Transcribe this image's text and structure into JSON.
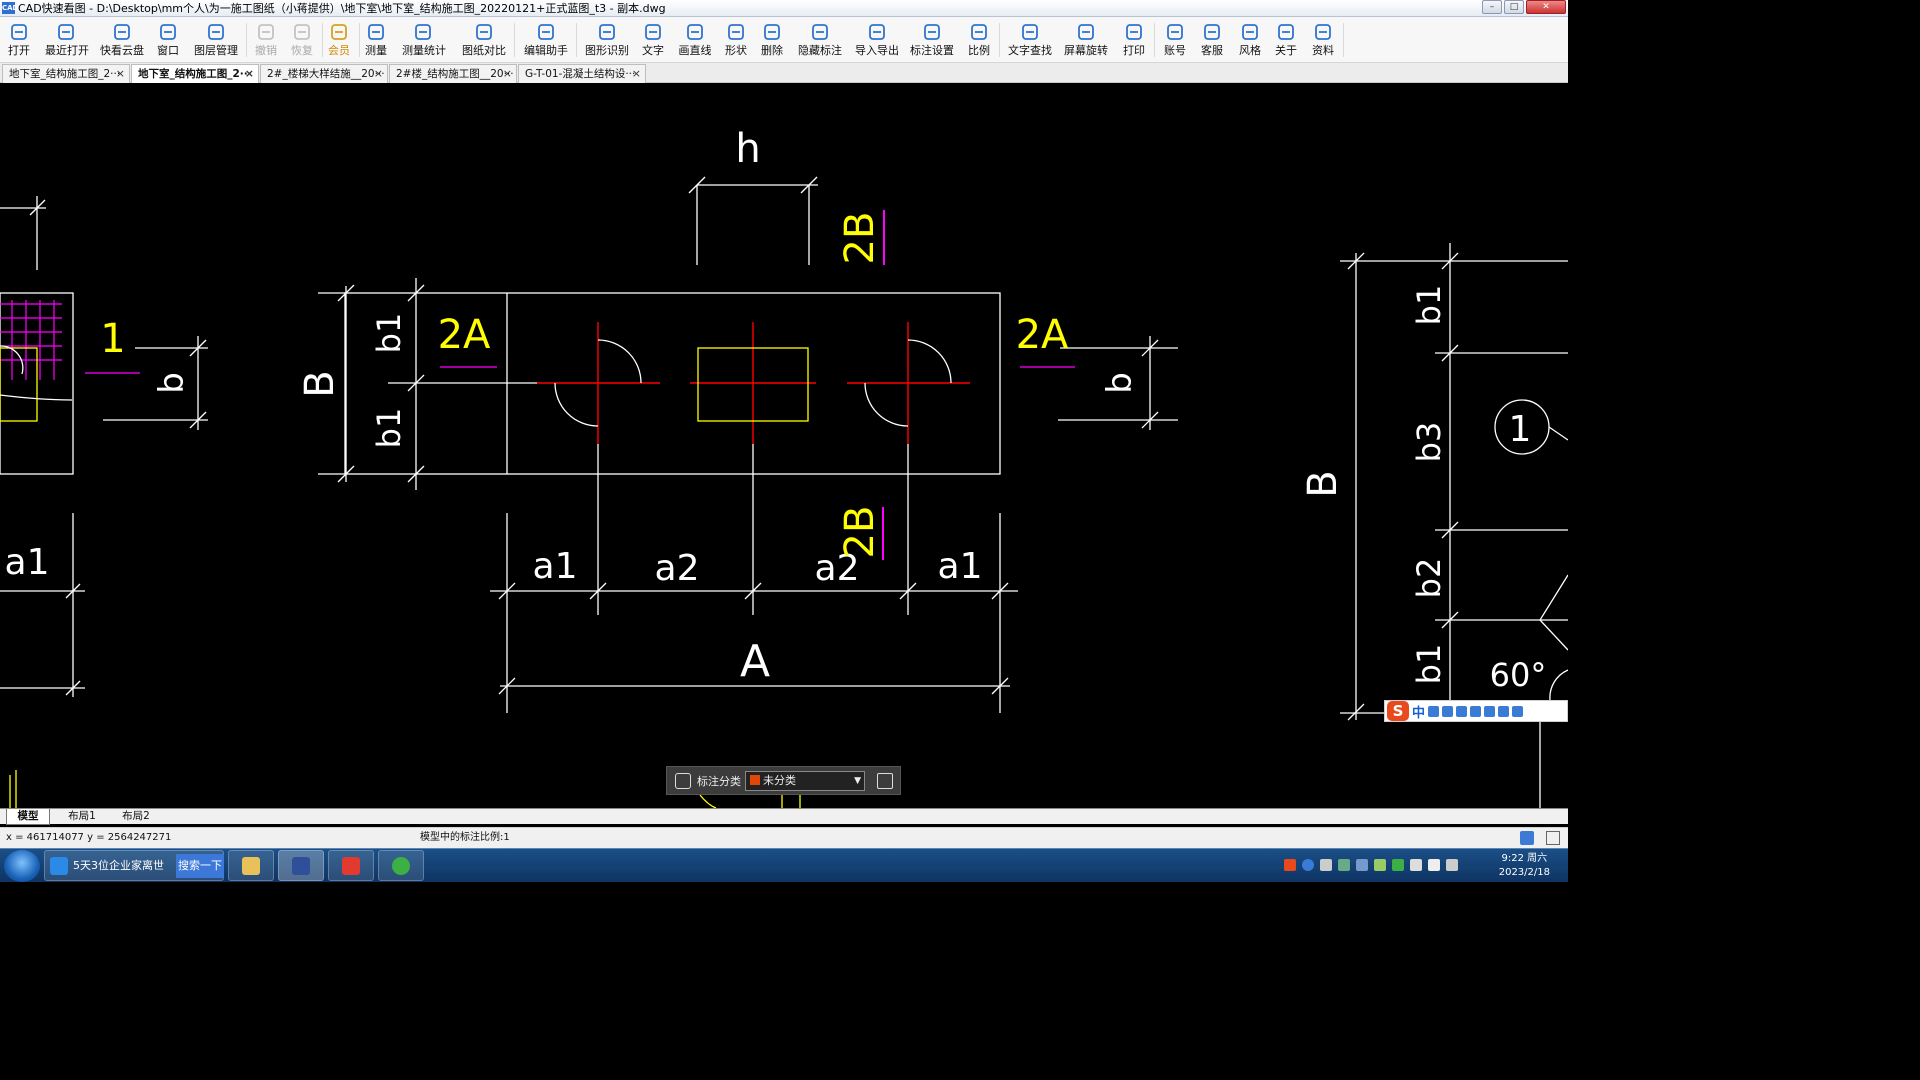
{
  "window": {
    "app_icon_text": "CAD",
    "title": "CAD快速看图 - D:\\Desktop\\mm个人\\为一施工图纸（小蒋提供）\\地下室\\地下室_结构施工图_20220121+正式蓝图_t3 - 副本.dwg",
    "buttons": [
      "–",
      "□",
      "✕"
    ]
  },
  "toolbar": [
    {
      "label": "打开",
      "icon": "folder-open-icon",
      "state": "normal"
    },
    {
      "label": "最近打开",
      "icon": "history-icon",
      "state": "normal"
    },
    {
      "label": "快看云盘",
      "icon": "cloud-icon",
      "state": "normal"
    },
    {
      "label": "窗口",
      "icon": "window-icon",
      "state": "normal"
    },
    {
      "label": "图层管理",
      "icon": "layers-icon",
      "state": "normal"
    },
    {
      "label": "撤销",
      "icon": "undo-icon",
      "state": "disabled"
    },
    {
      "label": "恢复",
      "icon": "redo-icon",
      "state": "disabled"
    },
    {
      "label": "会员",
      "icon": "vip-icon",
      "state": "vip"
    },
    {
      "label": "测量",
      "icon": "ruler-icon",
      "state": "normal"
    },
    {
      "label": "测量统计",
      "icon": "measure-stats-icon",
      "state": "normal"
    },
    {
      "label": "图纸对比",
      "icon": "compare-icon",
      "state": "normal"
    },
    {
      "label": "编辑助手",
      "icon": "edit-assistant-icon",
      "state": "normal"
    },
    {
      "label": "图形识别",
      "icon": "shape-recognition-icon",
      "state": "normal"
    },
    {
      "label": "文字",
      "icon": "text-icon",
      "state": "normal"
    },
    {
      "label": "画直线",
      "icon": "line-icon",
      "state": "normal"
    },
    {
      "label": "形状",
      "icon": "shape-icon",
      "state": "normal"
    },
    {
      "label": "删除",
      "icon": "eraser-icon",
      "state": "normal"
    },
    {
      "label": "隐藏标注",
      "icon": "hide-annotation-icon",
      "state": "normal"
    },
    {
      "label": "导入导出",
      "icon": "import-export-icon",
      "state": "normal"
    },
    {
      "label": "标注设置",
      "icon": "annotation-settings-icon",
      "state": "normal"
    },
    {
      "label": "比例",
      "icon": "scale-icon",
      "state": "normal"
    },
    {
      "label": "文字查找",
      "icon": "text-search-icon",
      "state": "normal"
    },
    {
      "label": "屏幕旋转",
      "icon": "rotate-screen-icon",
      "state": "normal"
    },
    {
      "label": "打印",
      "icon": "printer-icon",
      "state": "normal"
    },
    {
      "label": "账号",
      "icon": "user-icon",
      "state": "normal"
    },
    {
      "label": "客服",
      "icon": "headset-icon",
      "state": "normal"
    },
    {
      "label": "风格",
      "icon": "style-icon",
      "state": "normal"
    },
    {
      "label": "关于",
      "icon": "info-icon",
      "state": "normal"
    },
    {
      "label": "资料",
      "icon": "resources-icon",
      "state": "normal"
    }
  ],
  "tabs": [
    {
      "label": "地下室_结构施工图_2···",
      "active": false
    },
    {
      "label": "地下室_结构施工图_2···",
      "active": true
    },
    {
      "label": "2#_楼梯大样结施__20···",
      "active": false
    },
    {
      "label": "2#楼_结构施工图__20···",
      "active": false
    },
    {
      "label": "G-T-01-混凝土结构设···",
      "active": false
    }
  ],
  "drawing": {
    "labels_white": [
      "h",
      "B",
      "b",
      "b",
      "b1",
      "b1",
      "a1",
      "a2",
      "a2",
      "a1",
      "A",
      "a1",
      "B",
      "b1",
      "b3",
      "b2",
      "b1",
      "60°",
      "1"
    ],
    "labels_yellow": [
      "1",
      "2A",
      "2A",
      "2B",
      "2B"
    ],
    "colors": {
      "white": "#ffffff",
      "yellow": "#ffff00",
      "red": "#ff0000",
      "magenta": "#ff00ff",
      "background": "#000000"
    }
  },
  "annotation_bar": {
    "label": "标注分类",
    "selected": "未分类",
    "swatch_color": "#e2470a"
  },
  "ime": {
    "brand": "S",
    "mode": "中"
  },
  "layout_tabs": [
    {
      "label": "模型",
      "active": true
    },
    {
      "label": "布局1",
      "active": false
    },
    {
      "label": "布局2",
      "active": false
    }
  ],
  "status": {
    "coords": "x = 461714077  y = 2564247271",
    "scale_text": "模型中的标注比例:1"
  },
  "taskbar": {
    "items": [
      {
        "label": "5天3位企业家离世",
        "icon": "ie-icon"
      },
      {
        "label": "",
        "icon": "folder-icon"
      },
      {
        "label": "",
        "icon": "cad-icon"
      },
      {
        "label": "",
        "icon": "wps-icon"
      },
      {
        "label": "",
        "icon": "green-app-icon"
      }
    ],
    "search_button": "搜索一下",
    "clock_time": "9:22 周六",
    "clock_date": "2023/2/18"
  }
}
